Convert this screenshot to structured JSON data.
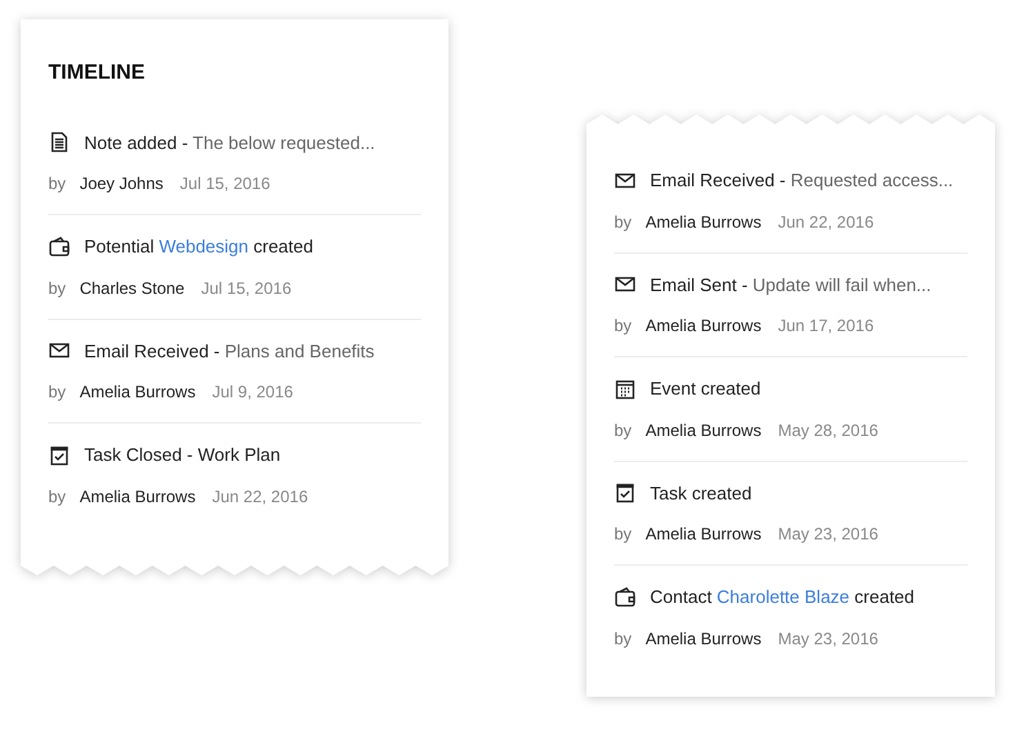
{
  "left_card": {
    "title": "TIMELINE",
    "entries": [
      {
        "kind": "note",
        "title": [
          {
            "kind": "plain",
            "text": "Note added - "
          },
          {
            "kind": "muted",
            "text": "The below requested..."
          }
        ],
        "by": "by",
        "author": "Joey Johns",
        "date": "Jul 15, 2016"
      },
      {
        "kind": "wallet",
        "title": [
          {
            "kind": "plain",
            "text": "Potential "
          },
          {
            "kind": "link",
            "text": "Webdesign"
          },
          {
            "kind": "plain",
            "text": " created"
          }
        ],
        "by": "by",
        "author": "Charles Stone",
        "date": "Jul 15, 2016"
      },
      {
        "kind": "mail",
        "title": [
          {
            "kind": "plain",
            "text": "Email Received - "
          },
          {
            "kind": "muted",
            "text": "Plans and Benefits"
          }
        ],
        "by": "by",
        "author": "Amelia Burrows",
        "date": "Jul 9, 2016"
      },
      {
        "kind": "task",
        "title": [
          {
            "kind": "plain",
            "text": "Task Closed - Work Plan"
          }
        ],
        "by": "by",
        "author": "Amelia Burrows",
        "date": "Jun 22, 2016"
      }
    ]
  },
  "right_card": {
    "entries": [
      {
        "kind": "mail",
        "title": [
          {
            "kind": "plain",
            "text": "Email Received - "
          },
          {
            "kind": "muted",
            "text": "Requested access..."
          }
        ],
        "by": "by",
        "author": "Amelia Burrows",
        "date": "Jun 22, 2016"
      },
      {
        "kind": "mail",
        "title": [
          {
            "kind": "plain",
            "text": "Email Sent - "
          },
          {
            "kind": "muted",
            "text": "Update will fail when..."
          }
        ],
        "by": "by",
        "author": "Amelia Burrows",
        "date": "Jun 17, 2016"
      },
      {
        "kind": "calendar",
        "title": [
          {
            "kind": "plain",
            "text": "Event created"
          }
        ],
        "by": "by",
        "author": "Amelia Burrows",
        "date": "May 28, 2016"
      },
      {
        "kind": "task",
        "title": [
          {
            "kind": "plain",
            "text": "Task created"
          }
        ],
        "by": "by",
        "author": "Amelia Burrows",
        "date": "May 23, 2016"
      },
      {
        "kind": "wallet",
        "title": [
          {
            "kind": "plain",
            "text": "Contact "
          },
          {
            "kind": "link",
            "text": "Charolette Blaze"
          },
          {
            "kind": "plain",
            "text": " created"
          }
        ],
        "by": "by",
        "author": "Amelia Burrows",
        "date": "May 23, 2016"
      }
    ]
  }
}
